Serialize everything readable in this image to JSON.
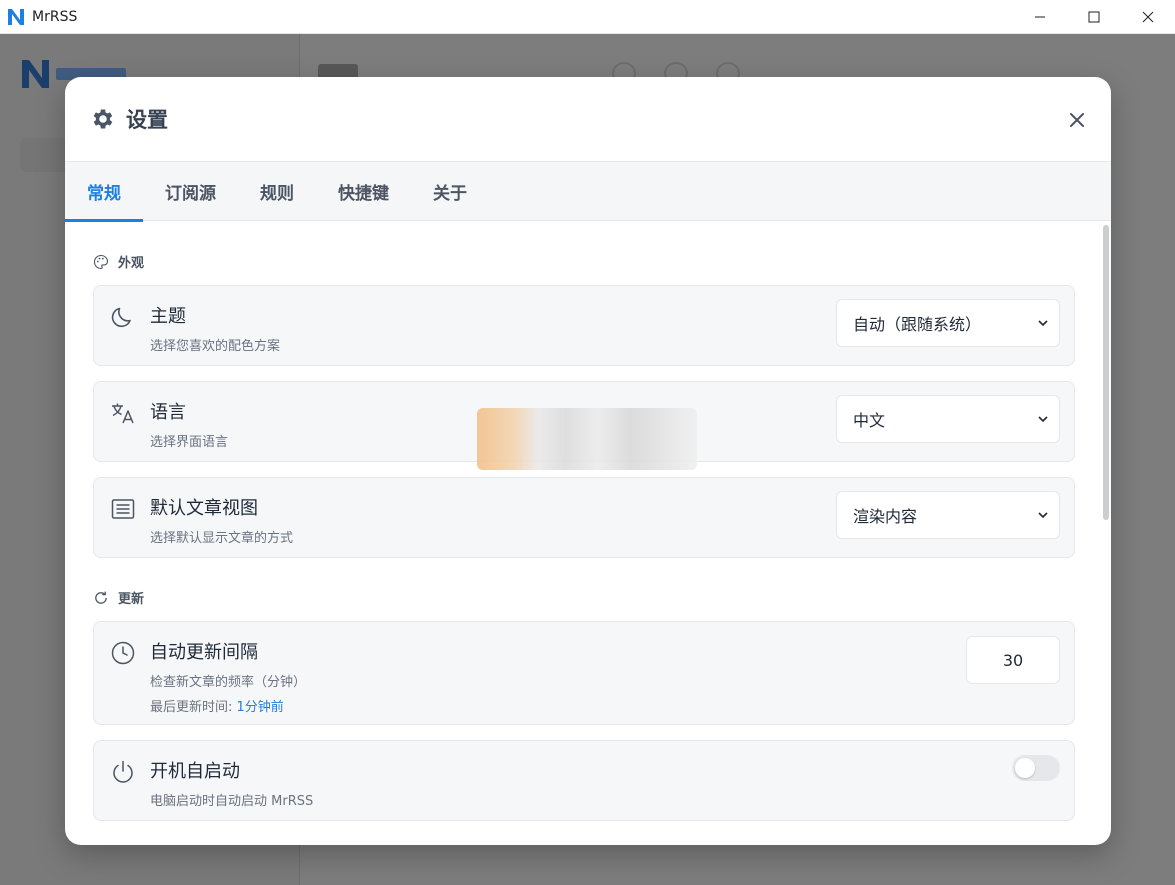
{
  "window": {
    "app_name": "MrRSS",
    "logo_letter": "N"
  },
  "dialog": {
    "title": "设置",
    "tabs": [
      {
        "label": "常规",
        "active": true
      },
      {
        "label": "订阅源",
        "active": false
      },
      {
        "label": "规则",
        "active": false
      },
      {
        "label": "快捷键",
        "active": false
      },
      {
        "label": "关于",
        "active": false
      }
    ],
    "sections": {
      "appearance": {
        "title": "外观",
        "icon": "palette-icon",
        "items": {
          "theme": {
            "label": "主题",
            "desc": "选择您喜欢的配色方案",
            "value": "自动（跟随系统）",
            "icon": "moon-icon"
          },
          "language": {
            "label": "语言",
            "desc": "选择界面语言",
            "value": "中文",
            "icon": "translate-icon"
          },
          "article_view": {
            "label": "默认文章视图",
            "desc": "选择默认显示文章的方式",
            "value": "渲染内容",
            "icon": "article-icon"
          }
        }
      },
      "update": {
        "title": "更新",
        "icon": "refresh-icon",
        "items": {
          "interval": {
            "label": "自动更新间隔",
            "desc": "检查新文章的频率（分钟）",
            "last_prefix": "最后更新时间: ",
            "last_value": "1分钟前",
            "value": "30",
            "icon": "clock-icon"
          },
          "autostart": {
            "label": "开机自启动",
            "desc": "电脑启动时自动启动 MrRSS",
            "enabled": false,
            "icon": "power-icon"
          }
        }
      }
    }
  },
  "colors": {
    "accent": "#1d7fe0",
    "overlay": "#808080",
    "card_bg": "#f6f7f9"
  }
}
